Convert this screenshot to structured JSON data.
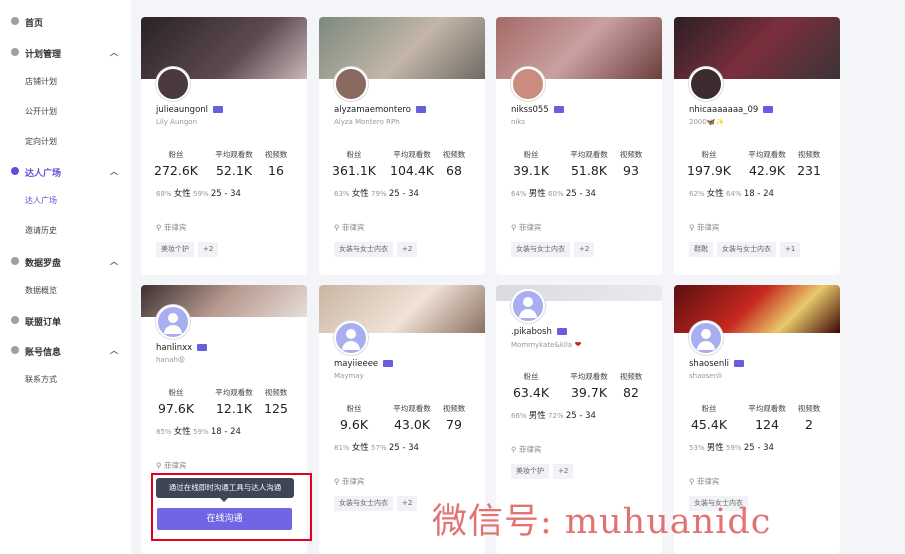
{
  "sidebar": {
    "items": [
      {
        "label": "首页",
        "type": "section",
        "icon": "home-icon"
      },
      {
        "label": "计划管理",
        "type": "section",
        "icon": "plan-icon",
        "chevron": "︿"
      },
      {
        "label": "店铺计划",
        "type": "sub"
      },
      {
        "label": "公开计划",
        "type": "sub"
      },
      {
        "label": "定向计划",
        "type": "sub"
      },
      {
        "label": "达人广场",
        "type": "section",
        "icon": "creator-square-icon",
        "chevron": "︿",
        "active": true
      },
      {
        "label": "达人广场",
        "type": "sub",
        "active": true
      },
      {
        "label": "邀请历史",
        "type": "sub"
      },
      {
        "label": "数据罗盘",
        "type": "section",
        "icon": "compass-icon",
        "chevron": "︿"
      },
      {
        "label": "数据概览",
        "type": "sub"
      },
      {
        "label": "联盟订单",
        "type": "section",
        "icon": "order-icon"
      },
      {
        "label": "账号信息",
        "type": "section",
        "icon": "account-icon",
        "chevron": "︿"
      },
      {
        "label": "联系方式",
        "type": "sub"
      }
    ]
  },
  "stat_labels": {
    "followers": "粉丝",
    "avg_views": "平均观看数",
    "videos": "视频数"
  },
  "creators": [
    {
      "username": "julieaungonl",
      "nickname": "Lily Aungon",
      "followers": "272.6K",
      "avg_views": "52.1K",
      "videos": "16",
      "gender_pct": "68%",
      "gender": "女性",
      "age_pct": "59%",
      "age": "25 - 34",
      "location": "菲律宾",
      "tags": [
        "美妆个护",
        "+2"
      ]
    },
    {
      "username": "alyzamaemontero",
      "nickname": "Alyza Montero RPh",
      "followers": "361.1K",
      "avg_views": "104.4K",
      "videos": "68",
      "gender_pct": "63%",
      "gender": "女性",
      "age_pct": "79%",
      "age": "25 - 34",
      "location": "菲律宾",
      "tags": [
        "女装与女士内衣",
        "+2"
      ]
    },
    {
      "username": "nikss055",
      "nickname": "niks",
      "followers": "39.1K",
      "avg_views": "51.8K",
      "videos": "93",
      "gender_pct": "64%",
      "gender": "男性",
      "age_pct": "60%",
      "age": "25 - 34",
      "location": "菲律宾",
      "tags": [
        "女装与女士内衣",
        "+2"
      ]
    },
    {
      "username": "nhicaaaaaaa_09",
      "nickname": "2000🦋✨",
      "followers": "197.9K",
      "avg_views": "42.9K",
      "videos": "231",
      "gender_pct": "62%",
      "gender": "女性",
      "age_pct": "64%",
      "age": "18 - 24",
      "location": "菲律宾",
      "tags": [
        "鞋靴",
        "女装与女士内衣",
        "+1"
      ]
    },
    {
      "username": "hanlinxx",
      "nickname": "hanah😩",
      "followers": "97.6K",
      "avg_views": "12.1K",
      "videos": "125",
      "gender_pct": "85%",
      "gender": "女性",
      "age_pct": "59%",
      "age": "18 - 24",
      "location": "菲律宾",
      "tags": []
    },
    {
      "username": "mayiieeee",
      "nickname": "Maymay",
      "followers": "9.6K",
      "avg_views": "43.0K",
      "videos": "79",
      "gender_pct": "81%",
      "gender": "女性",
      "age_pct": "57%",
      "age": "25 - 34",
      "location": "菲律宾",
      "tags": [
        "女装与女士内衣",
        "+2"
      ]
    },
    {
      "username": ".pikabosh",
      "nickname": "Mommykate&kila",
      "followers": "63.4K",
      "avg_views": "39.7K",
      "videos": "82",
      "gender_pct": "66%",
      "gender": "男性",
      "age_pct": "72%",
      "age": "25 - 34",
      "location": "菲律宾",
      "tags": [
        "美妆个护",
        "+2"
      ]
    },
    {
      "username": "shaosenli",
      "nickname": "shaosenli",
      "followers": "45.4K",
      "avg_views": "124",
      "videos": "2",
      "gender_pct": "53%",
      "gender": "男性",
      "age_pct": "59%",
      "age": "25 - 34",
      "location": "菲律宾",
      "tags": [
        "女装与女士内衣"
      ]
    }
  ],
  "tooltip": "通过在线即时沟通工具与达人沟通",
  "chat_button": "在线沟通",
  "watermark": "微信号: muhuanidc",
  "colors": {
    "accent": "#7165e3",
    "highlight_border": "#e3001b",
    "heart": "#d02020"
  }
}
